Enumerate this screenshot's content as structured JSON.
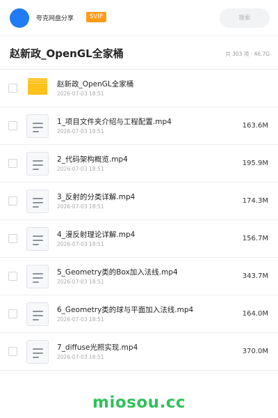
{
  "header": {
    "user_name": "夸克网盘分享",
    "badge": "SVIP",
    "search_placeholder": "搜索",
    "avatar_color": "#1f7cf5"
  },
  "folder": {
    "title": "赵新政_OpenGL全家桶",
    "summary": "共 303 项 · 46.7G"
  },
  "files": [
    {
      "type": "folder",
      "icon": "folder-icon",
      "name": "赵新政_OpenGL全家桶",
      "date": "2026-07-03 18:51",
      "size": ""
    },
    {
      "type": "video",
      "icon": "file-icon",
      "name": "1_项目文件夹介绍与工程配置.mp4",
      "date": "2026-07-03 18:51",
      "size": "163.6M"
    },
    {
      "type": "video",
      "icon": "file-icon",
      "name": "2_代码架构概览.mp4",
      "date": "2026-07-03 18:51",
      "size": "195.9M"
    },
    {
      "type": "video",
      "icon": "file-icon",
      "name": "3_反射的分类详解.mp4",
      "date": "2026-07-03 18:51",
      "size": "174.3M"
    },
    {
      "type": "video",
      "icon": "file-icon",
      "name": "4_漫反射理论详解.mp4",
      "date": "2026-07-03 18:51",
      "size": "156.7M"
    },
    {
      "type": "video",
      "icon": "file-icon",
      "name": "5_Geometry类的Box加入法线.mp4",
      "date": "2026-07-03 18:51",
      "size": "343.7M"
    },
    {
      "type": "video",
      "icon": "file-icon",
      "name": "6_Geometry类的球与平面加入法线.mp4",
      "date": "2026-07-03 18:51",
      "size": "164.0M"
    },
    {
      "type": "video",
      "icon": "file-icon",
      "name": "7_diffuse光照实现.mp4",
      "date": "2026-07-03 18:51",
      "size": "370.0M"
    }
  ],
  "footer": {
    "logo_text": "miosou.cc",
    "logo_color": "#30c05a"
  }
}
